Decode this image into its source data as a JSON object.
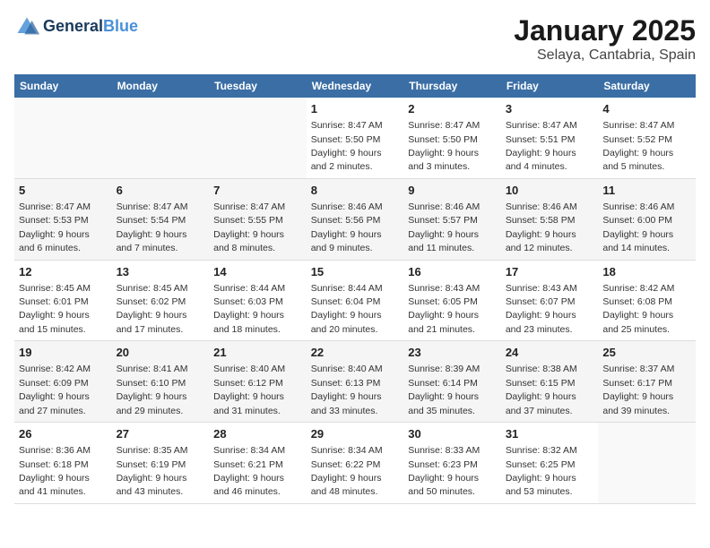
{
  "logo": {
    "line1": "General",
    "line2": "Blue"
  },
  "title": "January 2025",
  "subtitle": "Selaya, Cantabria, Spain",
  "weekdays": [
    "Sunday",
    "Monday",
    "Tuesday",
    "Wednesday",
    "Thursday",
    "Friday",
    "Saturday"
  ],
  "weeks": [
    [
      {
        "day": "",
        "info": ""
      },
      {
        "day": "",
        "info": ""
      },
      {
        "day": "",
        "info": ""
      },
      {
        "day": "1",
        "info": "Sunrise: 8:47 AM\nSunset: 5:50 PM\nDaylight: 9 hours\nand 2 minutes."
      },
      {
        "day": "2",
        "info": "Sunrise: 8:47 AM\nSunset: 5:50 PM\nDaylight: 9 hours\nand 3 minutes."
      },
      {
        "day": "3",
        "info": "Sunrise: 8:47 AM\nSunset: 5:51 PM\nDaylight: 9 hours\nand 4 minutes."
      },
      {
        "day": "4",
        "info": "Sunrise: 8:47 AM\nSunset: 5:52 PM\nDaylight: 9 hours\nand 5 minutes."
      }
    ],
    [
      {
        "day": "5",
        "info": "Sunrise: 8:47 AM\nSunset: 5:53 PM\nDaylight: 9 hours\nand 6 minutes."
      },
      {
        "day": "6",
        "info": "Sunrise: 8:47 AM\nSunset: 5:54 PM\nDaylight: 9 hours\nand 7 minutes."
      },
      {
        "day": "7",
        "info": "Sunrise: 8:47 AM\nSunset: 5:55 PM\nDaylight: 9 hours\nand 8 minutes."
      },
      {
        "day": "8",
        "info": "Sunrise: 8:46 AM\nSunset: 5:56 PM\nDaylight: 9 hours\nand 9 minutes."
      },
      {
        "day": "9",
        "info": "Sunrise: 8:46 AM\nSunset: 5:57 PM\nDaylight: 9 hours\nand 11 minutes."
      },
      {
        "day": "10",
        "info": "Sunrise: 8:46 AM\nSunset: 5:58 PM\nDaylight: 9 hours\nand 12 minutes."
      },
      {
        "day": "11",
        "info": "Sunrise: 8:46 AM\nSunset: 6:00 PM\nDaylight: 9 hours\nand 14 minutes."
      }
    ],
    [
      {
        "day": "12",
        "info": "Sunrise: 8:45 AM\nSunset: 6:01 PM\nDaylight: 9 hours\nand 15 minutes."
      },
      {
        "day": "13",
        "info": "Sunrise: 8:45 AM\nSunset: 6:02 PM\nDaylight: 9 hours\nand 17 minutes."
      },
      {
        "day": "14",
        "info": "Sunrise: 8:44 AM\nSunset: 6:03 PM\nDaylight: 9 hours\nand 18 minutes."
      },
      {
        "day": "15",
        "info": "Sunrise: 8:44 AM\nSunset: 6:04 PM\nDaylight: 9 hours\nand 20 minutes."
      },
      {
        "day": "16",
        "info": "Sunrise: 8:43 AM\nSunset: 6:05 PM\nDaylight: 9 hours\nand 21 minutes."
      },
      {
        "day": "17",
        "info": "Sunrise: 8:43 AM\nSunset: 6:07 PM\nDaylight: 9 hours\nand 23 minutes."
      },
      {
        "day": "18",
        "info": "Sunrise: 8:42 AM\nSunset: 6:08 PM\nDaylight: 9 hours\nand 25 minutes."
      }
    ],
    [
      {
        "day": "19",
        "info": "Sunrise: 8:42 AM\nSunset: 6:09 PM\nDaylight: 9 hours\nand 27 minutes."
      },
      {
        "day": "20",
        "info": "Sunrise: 8:41 AM\nSunset: 6:10 PM\nDaylight: 9 hours\nand 29 minutes."
      },
      {
        "day": "21",
        "info": "Sunrise: 8:40 AM\nSunset: 6:12 PM\nDaylight: 9 hours\nand 31 minutes."
      },
      {
        "day": "22",
        "info": "Sunrise: 8:40 AM\nSunset: 6:13 PM\nDaylight: 9 hours\nand 33 minutes."
      },
      {
        "day": "23",
        "info": "Sunrise: 8:39 AM\nSunset: 6:14 PM\nDaylight: 9 hours\nand 35 minutes."
      },
      {
        "day": "24",
        "info": "Sunrise: 8:38 AM\nSunset: 6:15 PM\nDaylight: 9 hours\nand 37 minutes."
      },
      {
        "day": "25",
        "info": "Sunrise: 8:37 AM\nSunset: 6:17 PM\nDaylight: 9 hours\nand 39 minutes."
      }
    ],
    [
      {
        "day": "26",
        "info": "Sunrise: 8:36 AM\nSunset: 6:18 PM\nDaylight: 9 hours\nand 41 minutes."
      },
      {
        "day": "27",
        "info": "Sunrise: 8:35 AM\nSunset: 6:19 PM\nDaylight: 9 hours\nand 43 minutes."
      },
      {
        "day": "28",
        "info": "Sunrise: 8:34 AM\nSunset: 6:21 PM\nDaylight: 9 hours\nand 46 minutes."
      },
      {
        "day": "29",
        "info": "Sunrise: 8:34 AM\nSunset: 6:22 PM\nDaylight: 9 hours\nand 48 minutes."
      },
      {
        "day": "30",
        "info": "Sunrise: 8:33 AM\nSunset: 6:23 PM\nDaylight: 9 hours\nand 50 minutes."
      },
      {
        "day": "31",
        "info": "Sunrise: 8:32 AM\nSunset: 6:25 PM\nDaylight: 9 hours\nand 53 minutes."
      },
      {
        "day": "",
        "info": ""
      }
    ]
  ]
}
